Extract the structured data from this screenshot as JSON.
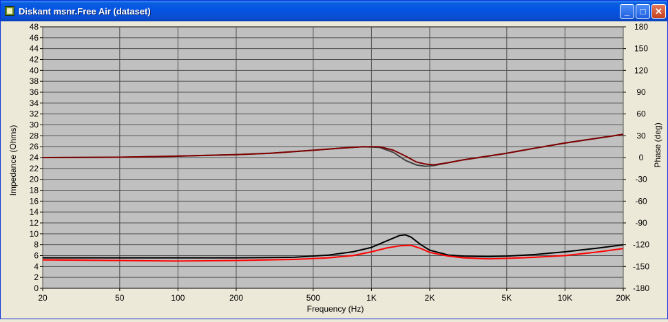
{
  "window": {
    "title": "Diskant msnr.Free Air (dataset)",
    "minimize_label": "_",
    "maximize_label": "□",
    "close_label": "✕"
  },
  "chart_data": {
    "type": "line",
    "xlabel": "Frequency (Hz)",
    "ylabel": "Impedance (Ohms)",
    "y2label": "Phase (deg)",
    "xscale": "log",
    "xlim": [
      20,
      20000
    ],
    "ylim": [
      0,
      48
    ],
    "y2lim": [
      -180,
      180
    ],
    "grid": true,
    "plot_background": "#c0c0c0",
    "x_ticks": [
      {
        "value": 20,
        "label": "20"
      },
      {
        "value": 50,
        "label": "50"
      },
      {
        "value": 100,
        "label": "100"
      },
      {
        "value": 200,
        "label": "200"
      },
      {
        "value": 500,
        "label": "500"
      },
      {
        "value": 1000,
        "label": "1K"
      },
      {
        "value": 2000,
        "label": "2K"
      },
      {
        "value": 5000,
        "label": "5K"
      },
      {
        "value": 10000,
        "label": "10K"
      },
      {
        "value": 20000,
        "label": "20K"
      }
    ],
    "y_ticks": [
      0,
      2,
      4,
      6,
      8,
      10,
      12,
      14,
      16,
      18,
      20,
      22,
      24,
      26,
      28,
      30,
      32,
      34,
      36,
      38,
      40,
      42,
      44,
      46,
      48
    ],
    "y2_ticks": [
      -180,
      -150,
      -120,
      -90,
      -60,
      -30,
      0,
      30,
      60,
      90,
      120,
      150,
      180
    ],
    "series": [
      {
        "color": "#000000",
        "axis": "left",
        "x": [
          20,
          50,
          100,
          200,
          400,
          600,
          800,
          1000,
          1200,
          1400,
          1500,
          1600,
          1800,
          2000,
          2500,
          3000,
          4000,
          5000,
          7000,
          10000,
          15000,
          20000
        ],
        "y": [
          5.6,
          5.6,
          5.6,
          5.6,
          5.7,
          6.1,
          6.7,
          7.5,
          8.7,
          9.7,
          9.8,
          9.4,
          8.0,
          7.0,
          6.1,
          5.9,
          5.8,
          5.9,
          6.2,
          6.7,
          7.4,
          8.0
        ]
      },
      {
        "color": "#ff0000",
        "axis": "left",
        "x": [
          20,
          50,
          100,
          200,
          400,
          600,
          800,
          1000,
          1200,
          1400,
          1600,
          1800,
          2000,
          2500,
          3000,
          4000,
          5000,
          7000,
          10000,
          15000,
          20000
        ],
        "y": [
          5.2,
          5.1,
          5.0,
          5.1,
          5.3,
          5.6,
          6.0,
          6.7,
          7.4,
          7.8,
          7.9,
          7.3,
          6.6,
          5.9,
          5.6,
          5.4,
          5.5,
          5.7,
          6.0,
          6.7,
          7.3
        ]
      },
      {
        "color": "#404040",
        "axis": "right",
        "x": [
          20,
          50,
          100,
          200,
          300,
          500,
          700,
          900,
          1100,
          1300,
          1500,
          1700,
          1900,
          2100,
          2500,
          3000,
          5000,
          7000,
          10000,
          15000,
          20000
        ],
        "y": [
          0,
          0.5,
          2,
          4,
          6,
          10,
          13,
          15,
          14,
          7,
          -4,
          -10,
          -12,
          -11,
          -7,
          -3,
          6,
          13,
          20,
          27,
          32
        ]
      },
      {
        "color": "#800000",
        "axis": "right",
        "x": [
          20,
          50,
          100,
          200,
          300,
          500,
          700,
          900,
          1100,
          1300,
          1500,
          1700,
          1900,
          2100,
          2500,
          3000,
          5000,
          7000,
          10000,
          15000,
          20000
        ],
        "y": [
          0,
          0.5,
          2,
          4,
          6,
          10,
          13,
          15,
          15,
          10,
          2,
          -6,
          -9,
          -10,
          -7,
          -3,
          6,
          13,
          20,
          27,
          32
        ]
      }
    ]
  }
}
